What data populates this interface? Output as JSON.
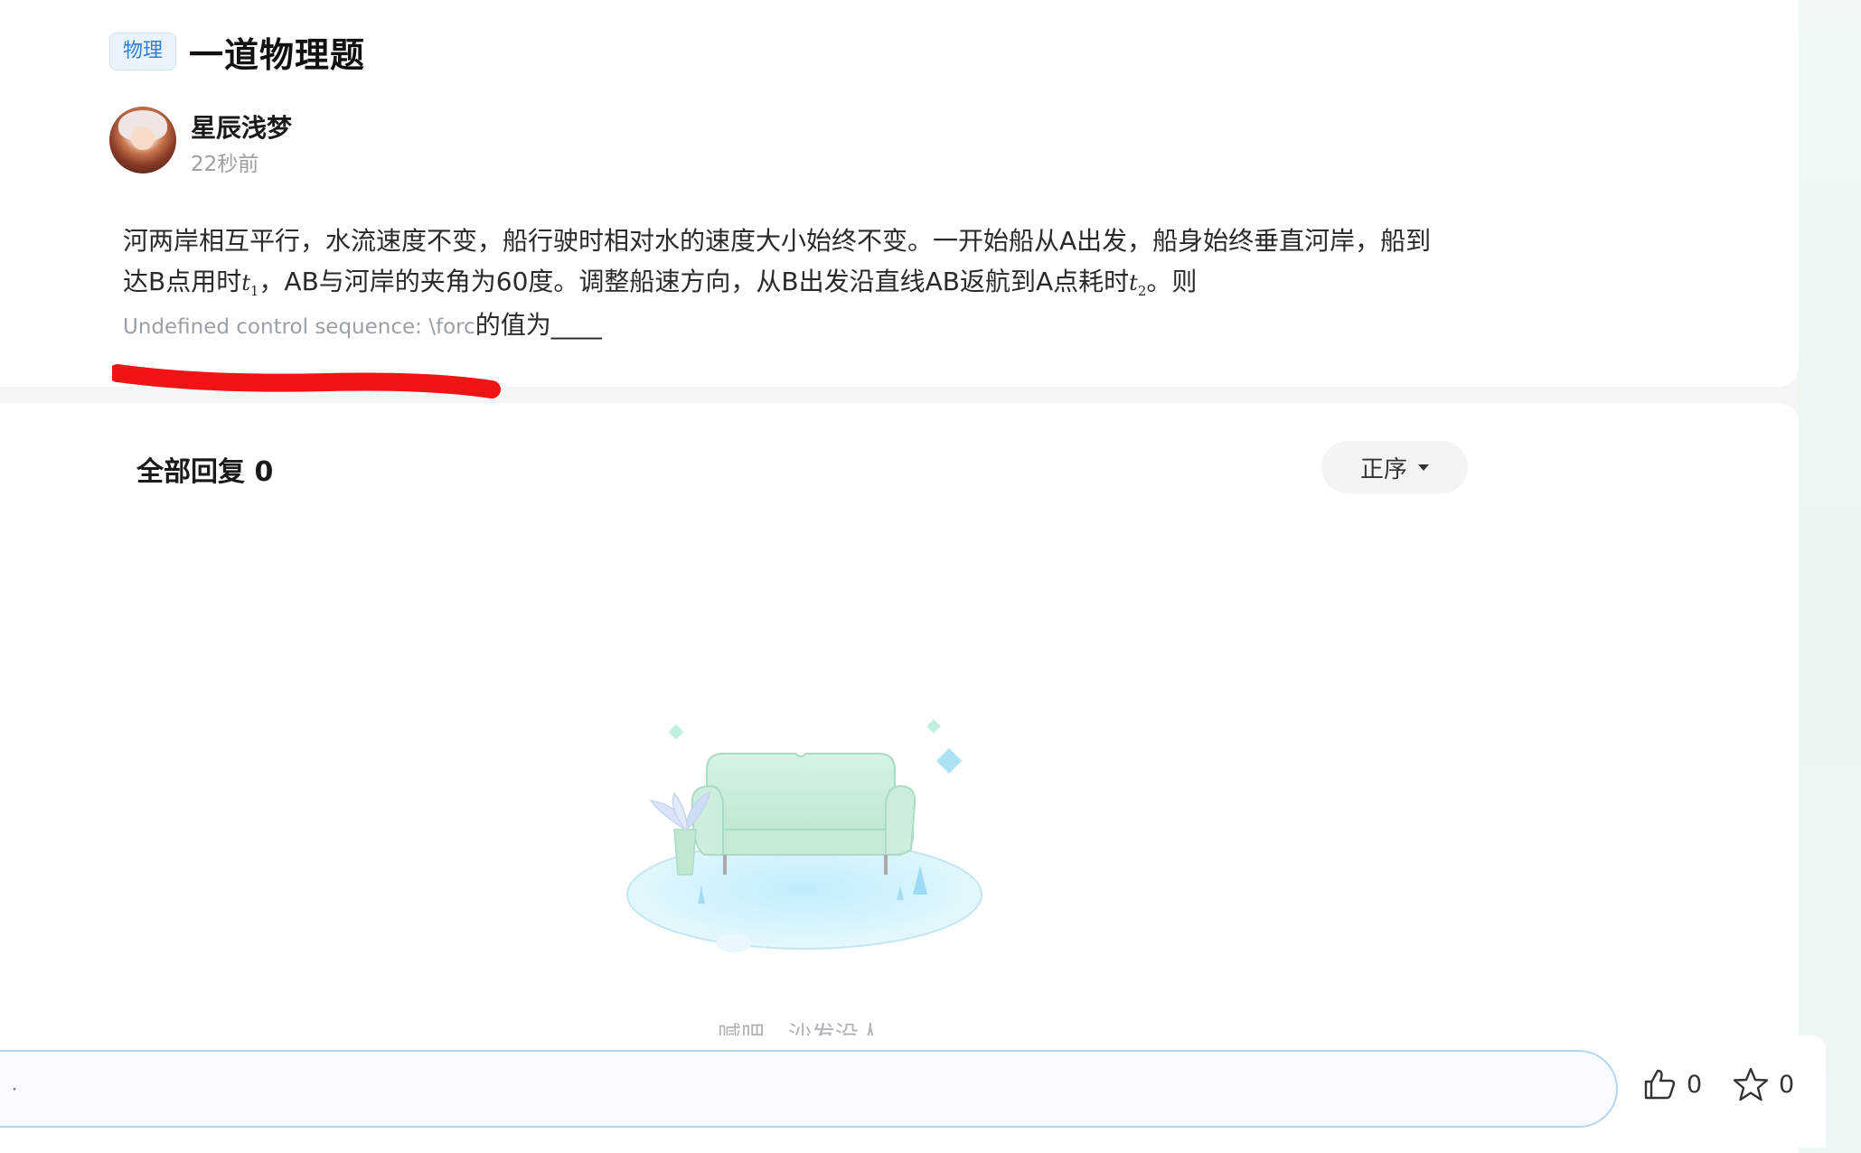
{
  "post": {
    "tag": "物理",
    "title": "一道物理题",
    "author": "星辰浅梦",
    "time": "22秒前",
    "body_line1": "河两岸相互平行，水流速度不变，船行驶时相对水的速度大小始终不变。一开始船从A出发，船身始终垂直河岸，船到",
    "body_line2_a": "达B点用时",
    "t1_base": "t",
    "t1_sub": "1",
    "body_line2_b": "，AB与河岸的夹角为60度。调整船速方向，从B出发沿直线AB返航到A点耗时",
    "t2_base": "t",
    "t2_sub": "2",
    "body_line2_c": "。则",
    "latex_error": "Undefined control sequence: \\forc",
    "body_tail": "的值为____"
  },
  "replies": {
    "title": "全部回复 0",
    "sort_label": "正序",
    "empty_text": "喊吧，沙发没人"
  },
  "bottom_bar": {
    "input_placeholder": "·",
    "like_count": "0",
    "favorite_count": "0"
  },
  "colors": {
    "tag_text": "#2f7ed8",
    "annotation_red": "#f01414",
    "sofa": "#c8ecd8"
  },
  "icons": [
    "thumbs-up-icon",
    "star-icon",
    "caret-down-icon",
    "sofa-illustration"
  ]
}
